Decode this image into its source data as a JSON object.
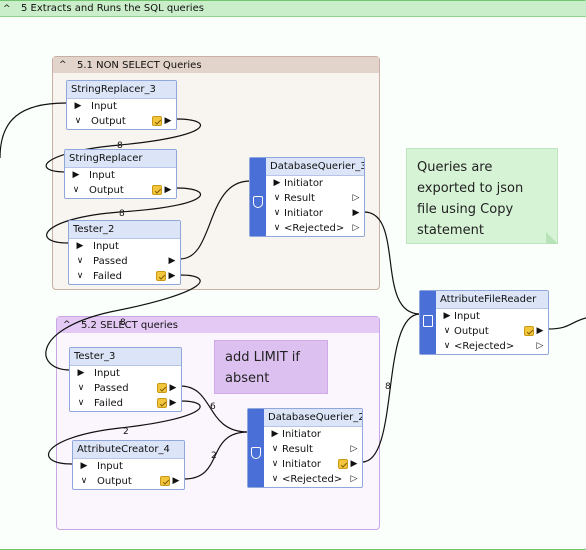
{
  "bookmarks": {
    "outer": {
      "title": "5 Extracts and Runs the SQL queries"
    },
    "non_select": {
      "title": "5.1 NON SELECT Queries"
    },
    "select": {
      "title": "5.2 SELECT queries"
    }
  },
  "transformers": {
    "string_replacer_3": {
      "title": "StringReplacer_3",
      "ports": [
        "Input",
        "Output"
      ]
    },
    "string_replacer": {
      "title": "StringReplacer",
      "ports": [
        "Input",
        "Output"
      ]
    },
    "tester_2": {
      "title": "Tester_2",
      "ports": [
        "Input",
        "Passed",
        "Failed"
      ]
    },
    "database_querier_3": {
      "title": "DatabaseQuerier_3",
      "ports": [
        "Initiator",
        "Result",
        "Initiator",
        "<Rejected>"
      ]
    },
    "attribute_file_reader": {
      "title": "AttributeFileReader",
      "ports": [
        "Input",
        "Output",
        "<Rejected>"
      ]
    },
    "tester_3": {
      "title": "Tester_3",
      "ports": [
        "Input",
        "Passed",
        "Failed"
      ]
    },
    "attribute_creator_4": {
      "title": "AttributeCreator_4",
      "ports": [
        "Input",
        "Output"
      ]
    },
    "database_querier_2": {
      "title": "DatabaseQuerier_2",
      "ports": [
        "Initiator",
        "Result",
        "Initiator",
        "<Rejected>"
      ]
    }
  },
  "annotations": {
    "json_export": "Queries are exported to json file using Copy statement",
    "limit": "add LIMIT if absent"
  },
  "feature_counts": {
    "sr3_to_sr": "8",
    "sr_to_tester2": "8",
    "tester2_failed": "8",
    "tester3_failed": "6",
    "ac4_in": "2",
    "ac4_out": "2",
    "dq2_to_afr": "8"
  },
  "icons": {
    "collapse": "chevron-up-icon",
    "port_in": "triangle-right-icon",
    "port_toggle": "chevron-down-icon",
    "inspect": "feature-inspect-icon",
    "database": "database-icon",
    "file_reader": "file-reader-icon"
  },
  "colors": {
    "outer_bookmark": "#c9eec9",
    "non_select_bookmark": "#e2d4ca",
    "select_bookmark": "#e4c9f4",
    "transformer_header": "#dce5f7",
    "querier_accent": "#4a6fd6",
    "annotation_green": "#d6f3d6",
    "annotation_purple": "#dcc1f0"
  }
}
